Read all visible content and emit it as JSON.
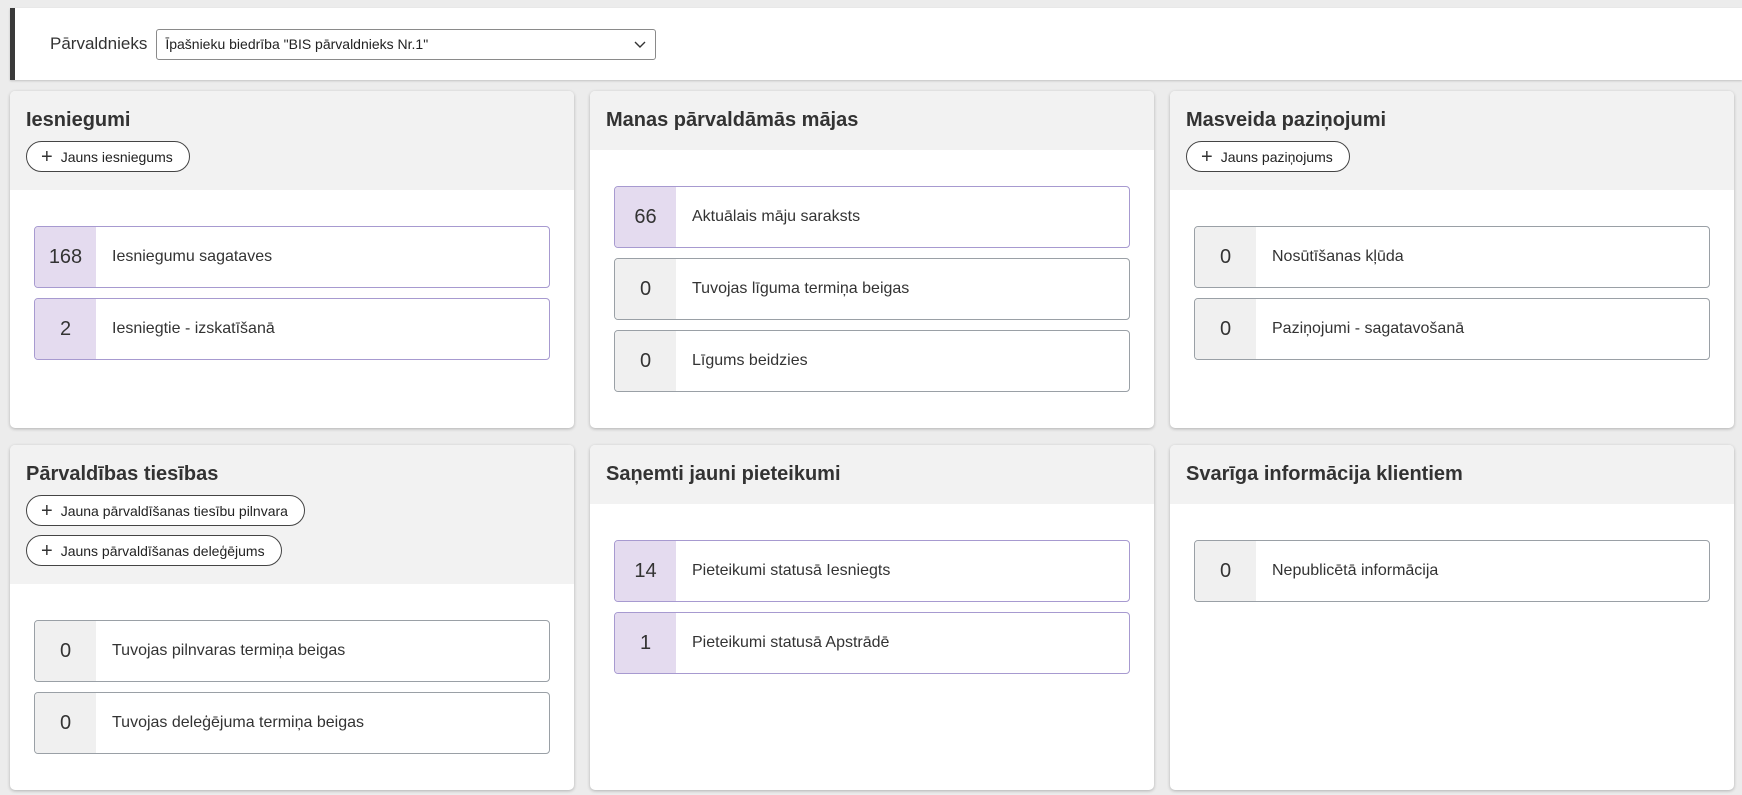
{
  "topbar": {
    "label": "Pārvaldnieks",
    "select_value": "Īpašnieku biedrība \"BIS pārvaldnieks Nr.1\""
  },
  "colors": {
    "accent_count_bg": "#e4dbef",
    "accent_border": "#a79ad0",
    "neutral_count_bg": "#f0f0f0"
  },
  "cards": {
    "submissions": {
      "title": "Iesniegumi",
      "actions": [
        "Jauns iesniegums"
      ],
      "items": [
        {
          "count": "168",
          "label": "Iesniegumu sagataves"
        },
        {
          "count": "2",
          "label": "Iesniegtie - izskatīšanā"
        }
      ]
    },
    "houses": {
      "title": "Manas pārvaldāmās mājas",
      "items": [
        {
          "count": "66",
          "label": "Aktuālais māju saraksts"
        },
        {
          "count": "0",
          "label": "Tuvojas līguma termiņa beigas"
        },
        {
          "count": "0",
          "label": "Līgums beidzies"
        }
      ]
    },
    "mass_notices": {
      "title": "Masveida paziņojumi",
      "actions": [
        "Jauns paziņojums"
      ],
      "items": [
        {
          "count": "0",
          "label": "Nosūtīšanas kļūda"
        },
        {
          "count": "0",
          "label": "Paziņojumi - sagatavošanā"
        }
      ]
    },
    "rights": {
      "title": "Pārvaldības tiesības",
      "actions": [
        "Jauna pārvaldīšanas tiesību pilnvara",
        "Jauns pārvaldīšanas deleģējums"
      ],
      "items": [
        {
          "count": "0",
          "label": "Tuvojas pilnvaras termiņa beigas"
        },
        {
          "count": "0",
          "label": "Tuvojas deleģējuma termiņa beigas"
        }
      ]
    },
    "applications": {
      "title": "Saņemti jauni pieteikumi",
      "items": [
        {
          "count": "14",
          "label": "Pieteikumi statusā Iesniegts"
        },
        {
          "count": "1",
          "label": "Pieteikumi statusā Apstrādē"
        }
      ]
    },
    "info": {
      "title": "Svarīga informācija klientiem",
      "items": [
        {
          "count": "0",
          "label": "Nepublicētā informācija"
        }
      ]
    }
  }
}
